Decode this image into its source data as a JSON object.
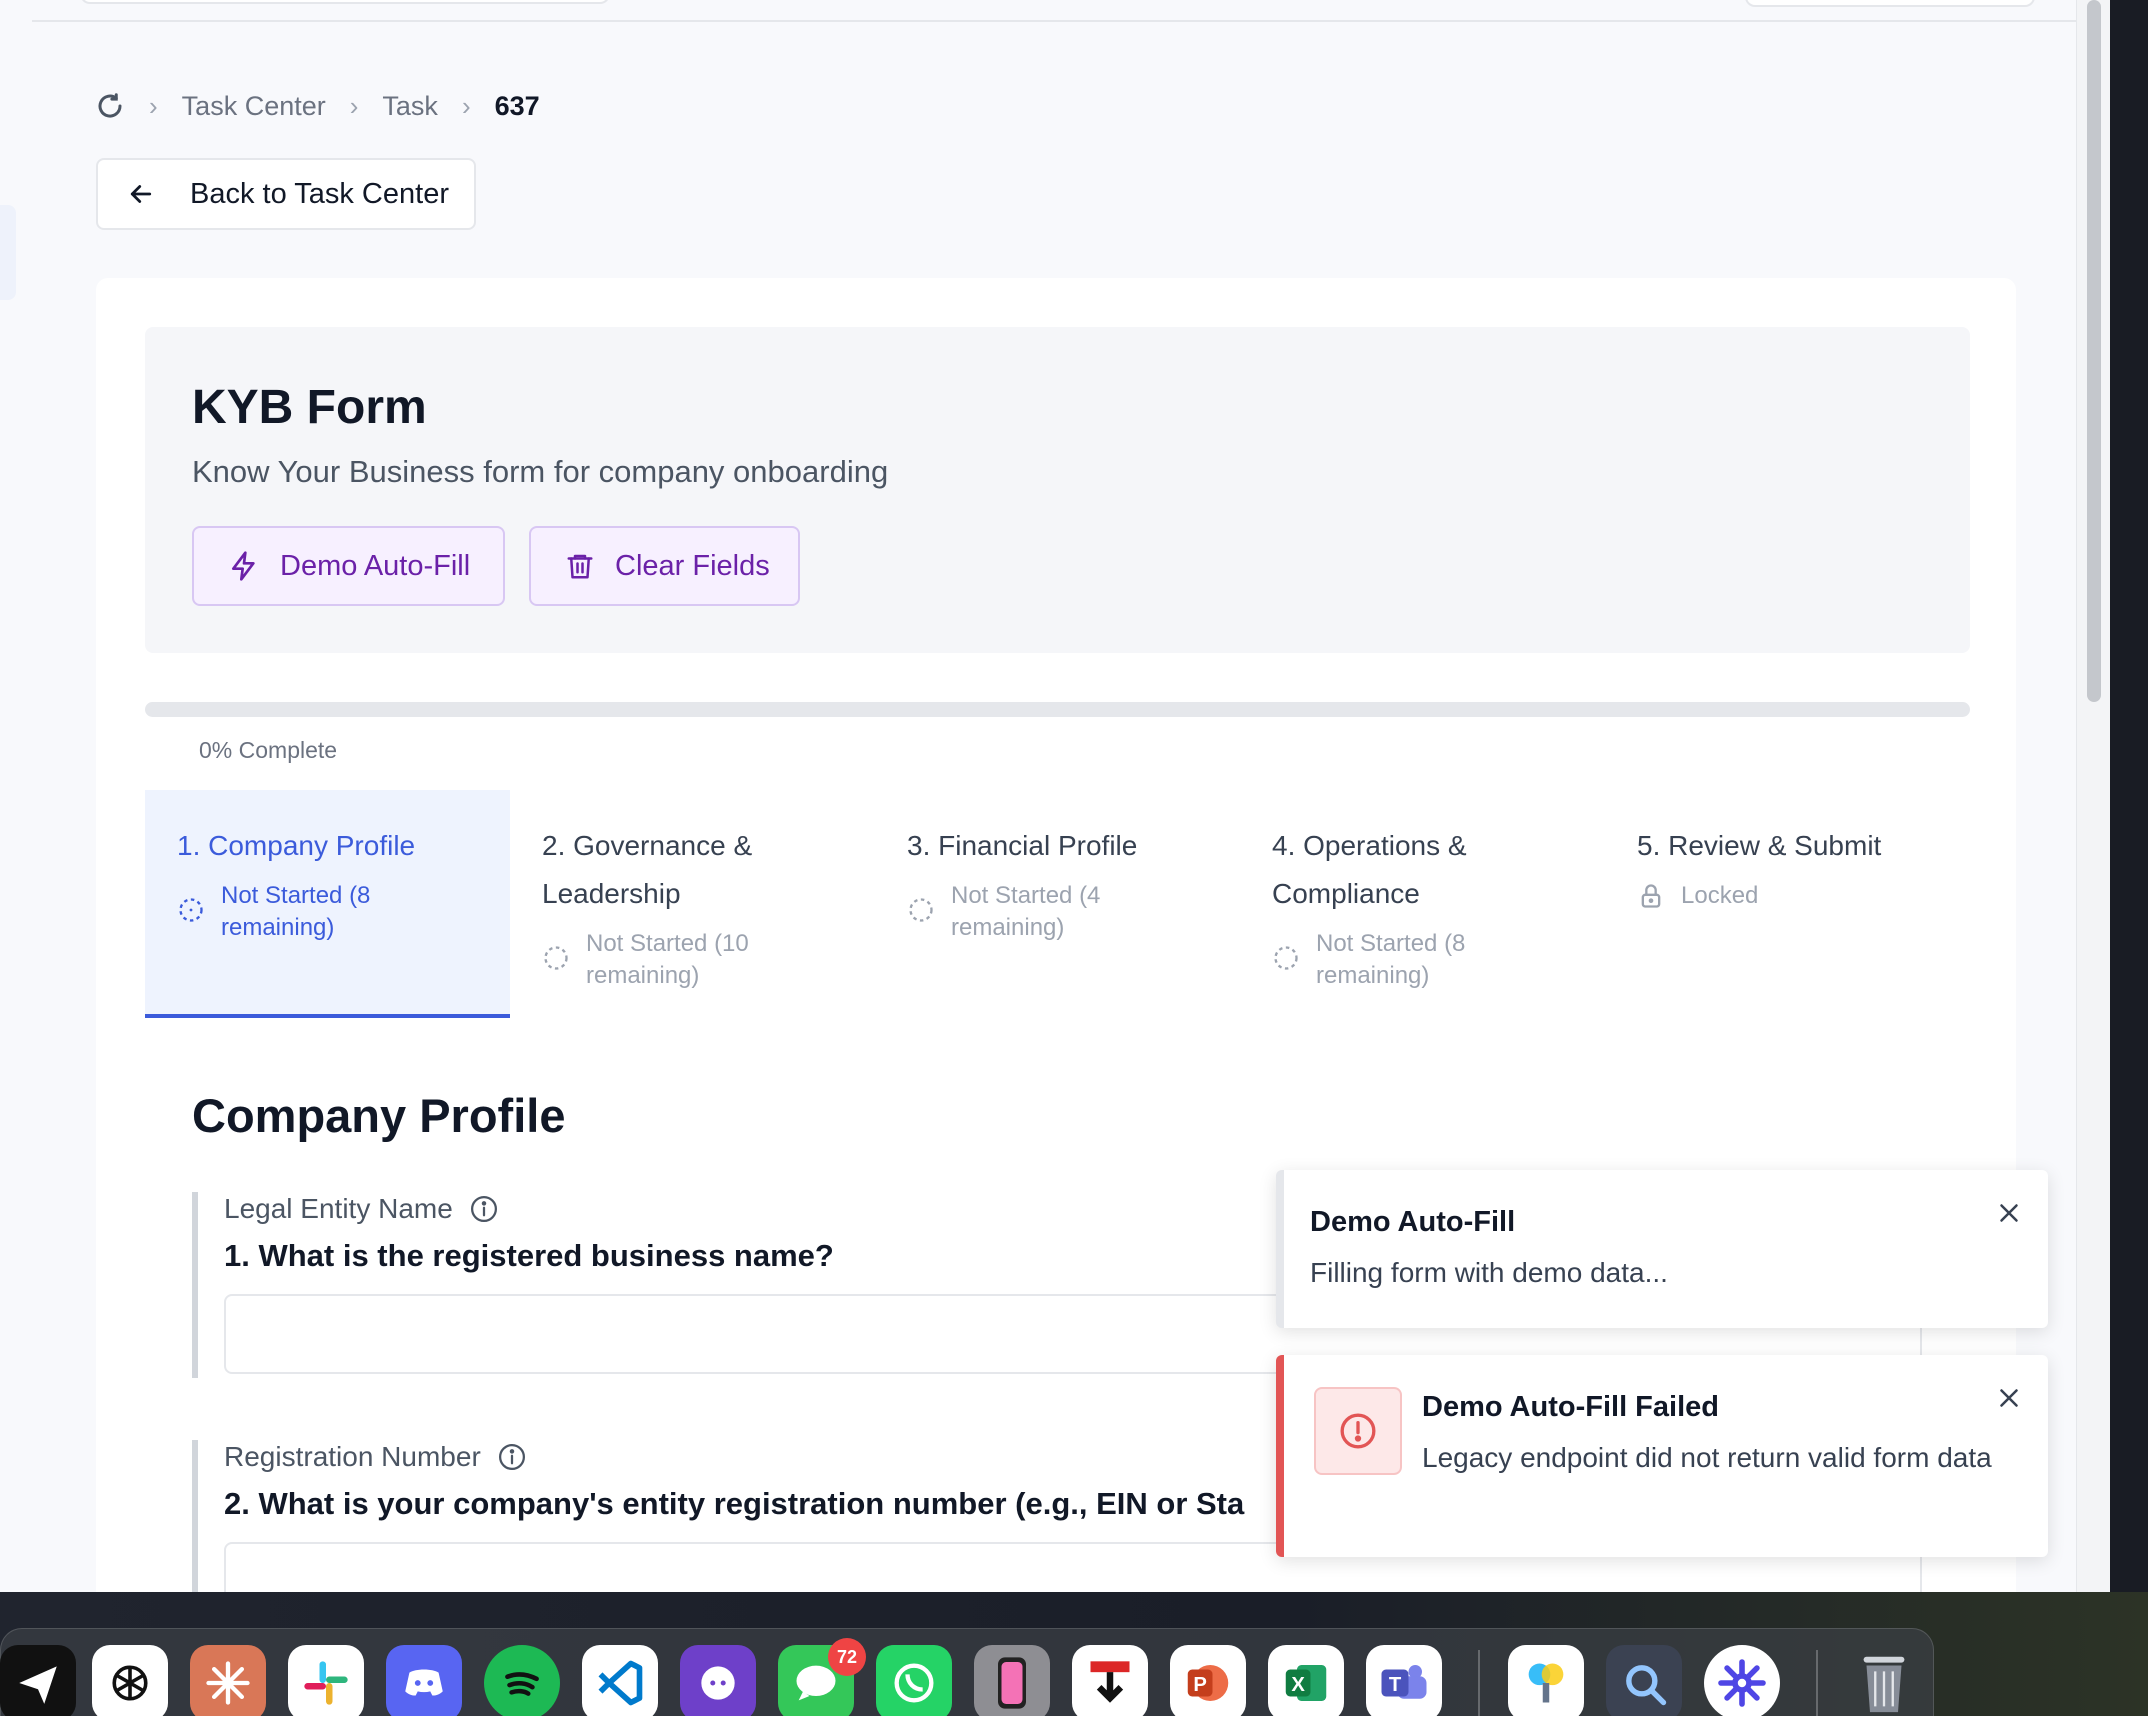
{
  "breadcrumb": {
    "items": [
      "Task Center",
      "Task"
    ],
    "current": "637"
  },
  "back_button": {
    "label": "Back to Task Center"
  },
  "form": {
    "title": "KYB Form",
    "subtitle": "Know Your Business form for company onboarding",
    "actions": {
      "demo_autofill": "Demo Auto-Fill",
      "clear_fields": "Clear Fields"
    }
  },
  "progress": {
    "percent": 0,
    "label": "0% Complete"
  },
  "steps": [
    {
      "title": "1. Company Profile",
      "status": "Not Started (8 remaining)",
      "active": true
    },
    {
      "title": "2. Governance & Leadership",
      "status": "Not Started (10 remaining)",
      "active": false
    },
    {
      "title": "3. Financial Profile",
      "status": "Not Started (4 remaining)",
      "active": false
    },
    {
      "title": "4. Operations & Compliance",
      "status": "Not Started (8 remaining)",
      "active": false
    },
    {
      "title": "5. Review & Submit",
      "status": "Locked",
      "active": false
    }
  ],
  "section": {
    "title": "Company Profile",
    "questions": [
      {
        "label": "Legal Entity Name",
        "text": "1. What is the registered business name?",
        "value": ""
      },
      {
        "label": "Registration Number",
        "text": "2. What is your company's entity registration number (e.g., EIN or Sta",
        "value": ""
      }
    ]
  },
  "toasts": {
    "info": {
      "title": "Demo Auto-Fill",
      "message": "Filling form with demo data..."
    },
    "error": {
      "title": "Demo Auto-Fill Failed",
      "message": "Legacy endpoint did not return valid form data"
    }
  },
  "colors": {
    "accent": "#3b5bdb",
    "purple": "#6b21a8",
    "error": "#e25555"
  },
  "dock": {
    "messages_badge": "72"
  }
}
